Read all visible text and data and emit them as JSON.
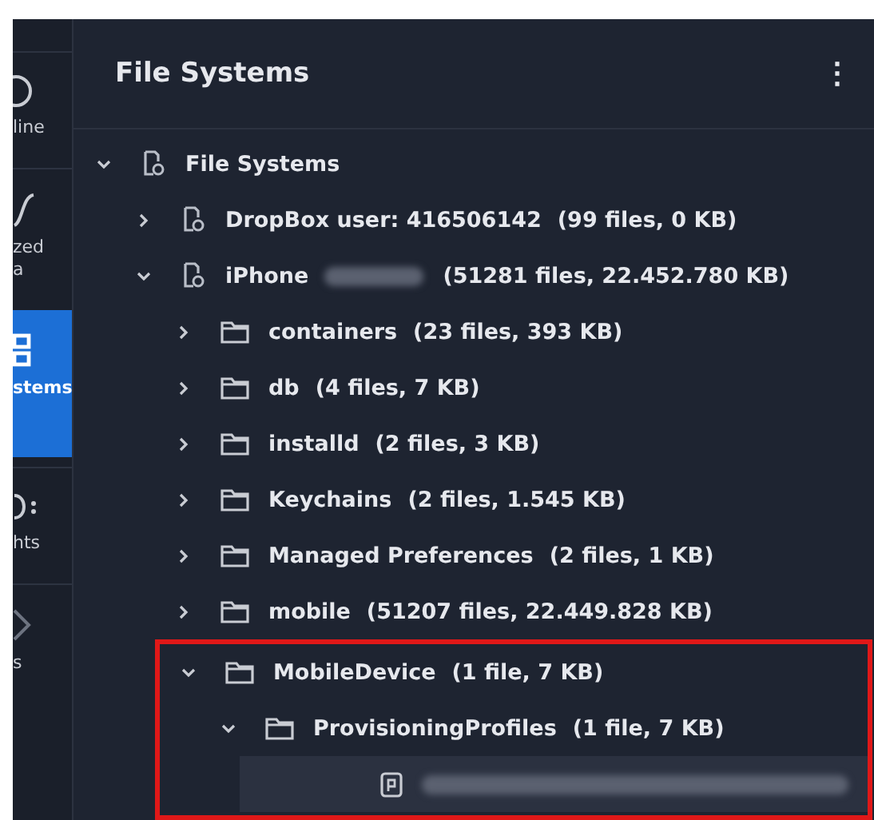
{
  "sidebar": {
    "items": [
      {
        "label_lines": [
          "line"
        ],
        "selected": false
      },
      {
        "label_lines": [
          "zed",
          "a"
        ],
        "selected": false
      },
      {
        "label_lines": [
          "stems"
        ],
        "selected": true
      },
      {
        "label_lines": [
          "hts"
        ],
        "selected": false
      },
      {
        "label_lines": [
          "s"
        ],
        "selected": false
      }
    ]
  },
  "panel": {
    "title": "File Systems",
    "menu_icon": "⋮"
  },
  "tree": [
    {
      "kind": "drive",
      "name": "File Systems",
      "expanded": true,
      "selected": false,
      "children": [
        {
          "kind": "drive",
          "name": "DropBox user: 416506142",
          "count": "(99 files, 0 KB)",
          "expanded": false,
          "selected": false
        },
        {
          "kind": "drive",
          "name": "iPhone",
          "redacted": true,
          "count": "(51281 files, 22.452.780 KB)",
          "expanded": true,
          "selected": false,
          "children": [
            {
              "kind": "folder",
              "name": "containers",
              "count": "(23 files, 393 KB)",
              "expanded": false,
              "selected": false
            },
            {
              "kind": "folder",
              "name": "db",
              "count": "(4 files, 7 KB)",
              "expanded": false,
              "selected": false
            },
            {
              "kind": "folder",
              "name": "installd",
              "count": "(2 files, 3 KB)",
              "expanded": false,
              "selected": false
            },
            {
              "kind": "folder",
              "name": "Keychains",
              "count": "(2 files, 1.545 KB)",
              "expanded": false,
              "selected": false
            },
            {
              "kind": "folder",
              "name": "Managed Preferences",
              "count": "(2 files, 1 KB)",
              "expanded": false,
              "selected": false
            },
            {
              "kind": "folder",
              "name": "mobile",
              "count": "(51207 files, 22.449.828 KB)",
              "expanded": false,
              "selected": false
            },
            {
              "kind": "folder",
              "name": "MobileDevice",
              "count": "(1 file, 7 KB)",
              "expanded": true,
              "selected": false,
              "highlight": true,
              "children": [
                {
                  "kind": "folder",
                  "name": "ProvisioningProfiles",
                  "count": "(1 file, 7 KB)",
                  "expanded": true,
                  "selected": false,
                  "children": [
                    {
                      "kind": "file",
                      "redacted": true,
                      "selected": true
                    }
                  ]
                }
              ]
            }
          ]
        }
      ]
    }
  ]
}
